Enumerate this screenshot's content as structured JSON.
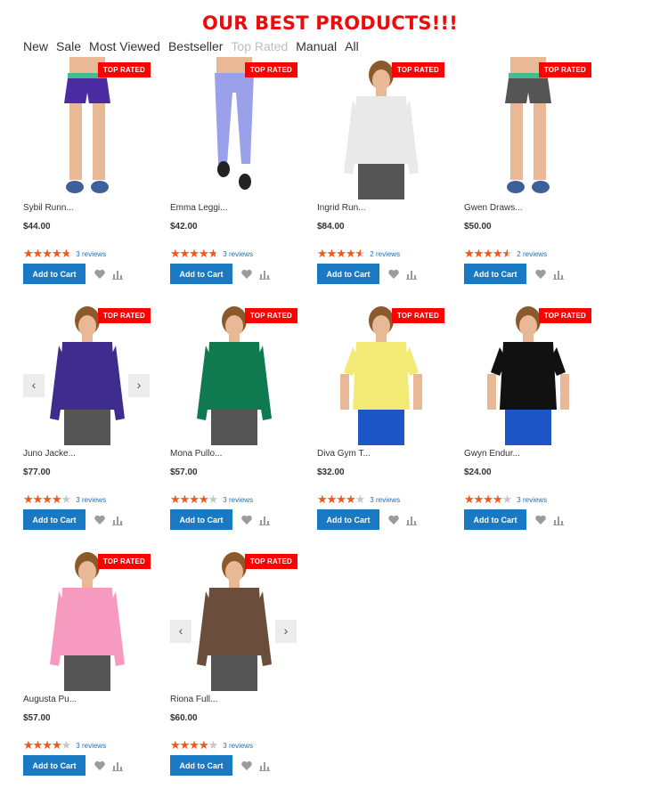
{
  "heading": "OUR BEST PRODUCTS!!!",
  "tabs": [
    {
      "label": "New",
      "active": false
    },
    {
      "label": "Sale",
      "active": false
    },
    {
      "label": "Most Viewed",
      "active": false
    },
    {
      "label": "Bestseller",
      "active": false
    },
    {
      "label": "Top Rated",
      "active": true
    },
    {
      "label": "Manual",
      "active": false
    },
    {
      "label": "All",
      "active": false
    }
  ],
  "badge_label": "TOP RATED",
  "add_to_cart_label": "Add to Cart",
  "colors": {
    "accent": "#1979c3",
    "badge": "#ff0000",
    "heading": "#ee0b0b",
    "star": "#ef5a1a"
  },
  "products": [
    {
      "name": "Sybil Runn...",
      "price": "$44.00",
      "rating": 4.8,
      "reviews": "3 reviews",
      "carousel": false,
      "garment": "shorts",
      "color": "#4b2ca3"
    },
    {
      "name": "Emma Leggi...",
      "price": "$42.00",
      "rating": 4.8,
      "reviews": "3 reviews",
      "carousel": false,
      "garment": "leggings",
      "color": "#9aa0ea"
    },
    {
      "name": "Ingrid Run...",
      "price": "$84.00",
      "rating": 4.6,
      "reviews": "2 reviews",
      "carousel": false,
      "garment": "jacket",
      "color": "#e9e9e9"
    },
    {
      "name": "Gwen Draws...",
      "price": "$50.00",
      "rating": 4.6,
      "reviews": "2 reviews",
      "carousel": false,
      "garment": "shorts",
      "color": "#555555"
    },
    {
      "name": "Juno Jacke...",
      "price": "$77.00",
      "rating": 4.0,
      "reviews": "3 reviews",
      "carousel": true,
      "garment": "jacket",
      "color": "#3e2c8f"
    },
    {
      "name": "Mona Pullo...",
      "price": "$57.00",
      "rating": 4.0,
      "reviews": "3 reviews",
      "carousel": false,
      "garment": "top",
      "color": "#0f7a4f"
    },
    {
      "name": "Diva Gym T...",
      "price": "$32.00",
      "rating": 4.0,
      "reviews": "3 reviews",
      "carousel": false,
      "garment": "tee",
      "color": "#f2ea74"
    },
    {
      "name": "Gwyn Endur...",
      "price": "$24.00",
      "rating": 4.0,
      "reviews": "3 reviews",
      "carousel": false,
      "garment": "tee",
      "color": "#111111"
    },
    {
      "name": "Augusta Pu...",
      "price": "$57.00",
      "rating": 4.0,
      "reviews": "3 reviews",
      "carousel": false,
      "garment": "top",
      "color": "#f79ac0"
    },
    {
      "name": "Riona Full...",
      "price": "$60.00",
      "rating": 4.0,
      "reviews": "3 reviews",
      "carousel": true,
      "garment": "jacket",
      "color": "#6b4d3c"
    }
  ]
}
